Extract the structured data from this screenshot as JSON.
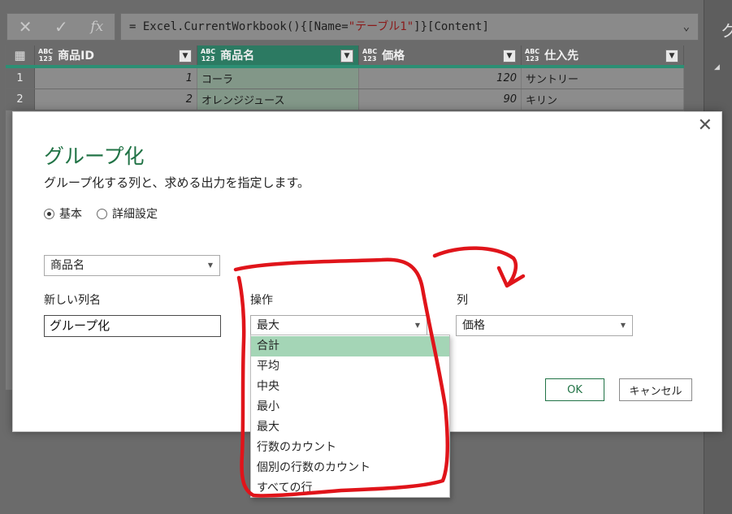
{
  "formula_bar": {
    "cancel_icon": "close-icon",
    "confirm_icon": "check-icon",
    "fx_label": "fx",
    "formula_prefix": "= Excel.CurrentWorkbook(){[Name=",
    "formula_string": "\"テーブル1\"",
    "formula_suffix": "]}[Content]"
  },
  "grid": {
    "columns": [
      {
        "type_top": "ABC",
        "type_bottom": "123",
        "label": "商品ID"
      },
      {
        "type_top": "ABC",
        "type_bottom": "123",
        "label": "商品名"
      },
      {
        "type_top": "ABC",
        "type_bottom": "123",
        "label": "価格"
      },
      {
        "type_top": "ABC",
        "type_bottom": "123",
        "label": "仕入先"
      }
    ],
    "rows": [
      {
        "num": "1",
        "id": "1",
        "name": "コーラ",
        "price": "120",
        "supplier": "サントリー"
      },
      {
        "num": "2",
        "id": "2",
        "name": "オレンジジュース",
        "price": "90",
        "supplier": "キリン"
      }
    ]
  },
  "right_pane": {
    "title_fragment": "ク"
  },
  "dialog": {
    "title": "グループ化",
    "description": "グループ化する列と、求める出力を指定します。",
    "radio_basic": "基本",
    "radio_advanced": "詳細設定",
    "group_by_value": "商品名",
    "new_column_label": "新しい列名",
    "new_column_value": "グループ化",
    "operation_label": "操作",
    "operation_value": "最大",
    "column_label": "列",
    "column_value": "価格",
    "ok_label": "OK",
    "cancel_label": "キャンセル"
  },
  "dropdown": {
    "items": [
      "合計",
      "平均",
      "中央",
      "最小",
      "最大",
      "行数のカウント",
      "個別の行数のカウント",
      "すべての行"
    ],
    "highlighted_index": 0
  },
  "colors": {
    "accent_green": "#217346",
    "highlight_green": "#a4d5b6",
    "annotation_red": "#e0141a"
  }
}
